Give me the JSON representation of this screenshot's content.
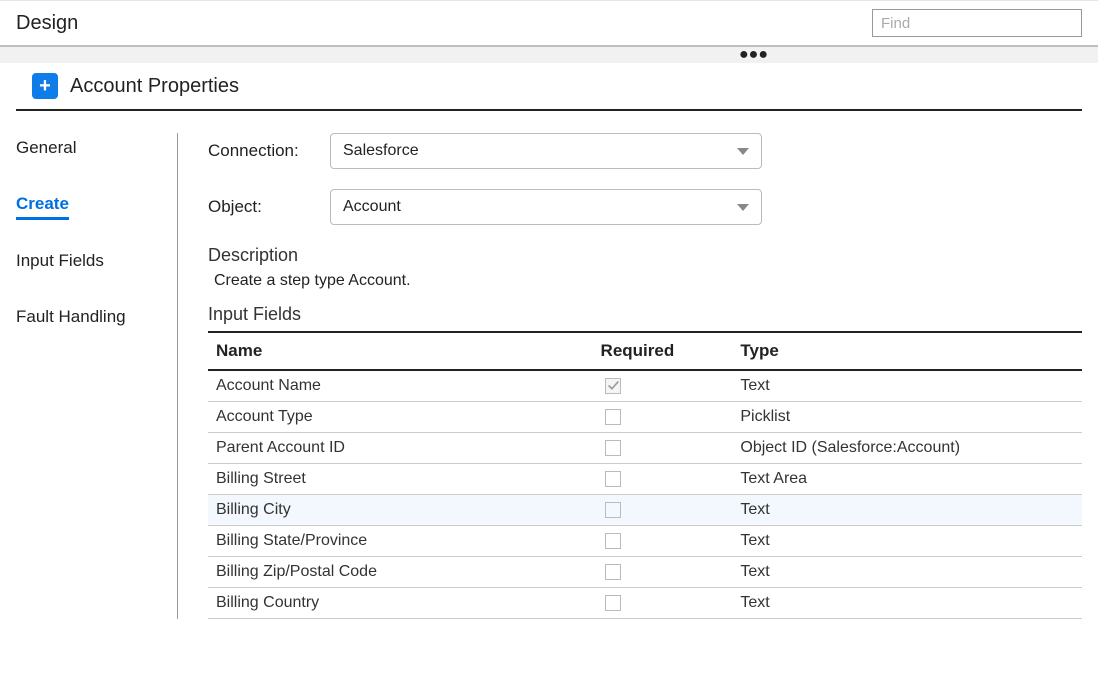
{
  "header": {
    "title": "Design",
    "find_placeholder": "Find"
  },
  "panel": {
    "title": "Account Properties"
  },
  "tabs": [
    {
      "label": "General",
      "active": false
    },
    {
      "label": "Create",
      "active": true
    },
    {
      "label": "Input Fields",
      "active": false
    },
    {
      "label": "Fault Handling",
      "active": false
    }
  ],
  "form": {
    "connection_label": "Connection:",
    "connection_value": "Salesforce",
    "object_label": "Object:",
    "object_value": "Account",
    "description_label": "Description",
    "description_text": "Create a step type Account.",
    "input_fields_label": "Input Fields"
  },
  "table": {
    "columns": {
      "name": "Name",
      "required": "Required",
      "type": "Type"
    },
    "rows": [
      {
        "name": "Account Name",
        "required": true,
        "disabled": true,
        "type": "Text"
      },
      {
        "name": "Account Type",
        "required": false,
        "type": "Picklist"
      },
      {
        "name": "Parent Account ID",
        "required": false,
        "type": "Object ID (Salesforce:Account)"
      },
      {
        "name": "Billing Street",
        "required": false,
        "type": "Text Area"
      },
      {
        "name": "Billing City",
        "required": false,
        "type": "Text",
        "highlight": true
      },
      {
        "name": "Billing State/Province",
        "required": false,
        "type": "Text"
      },
      {
        "name": "Billing Zip/Postal Code",
        "required": false,
        "type": "Text"
      },
      {
        "name": "Billing Country",
        "required": false,
        "type": "Text"
      }
    ]
  }
}
